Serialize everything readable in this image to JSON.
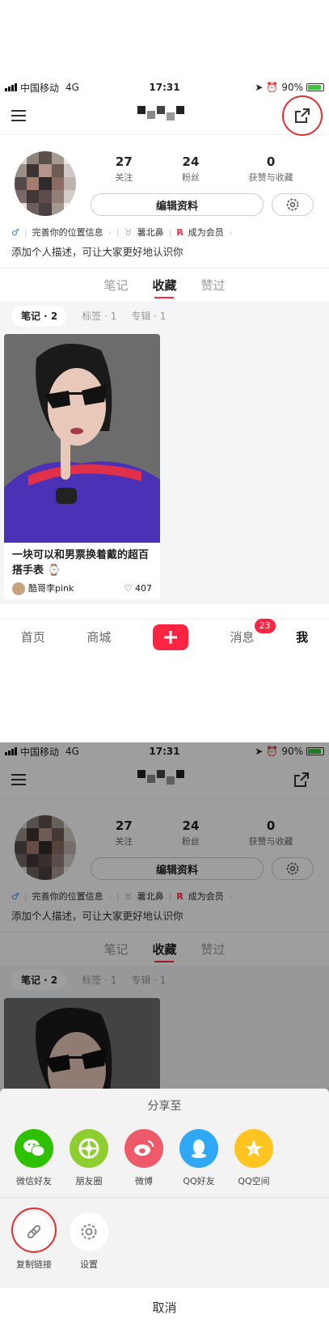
{
  "status_bar": {
    "carrier": "中国移动",
    "network": "4G",
    "time": "17:31",
    "battery": "90%"
  },
  "profile": {
    "stats": [
      {
        "value": "27",
        "label": "关注"
      },
      {
        "value": "24",
        "label": "粉丝"
      },
      {
        "value": "0",
        "label": "获赞与收藏"
      }
    ],
    "edit_label": "编辑资料",
    "tags": [
      "完善你的位置信息",
      "薯北鼻",
      "成为会员"
    ],
    "description": "添加个人描述，可让大家更好地认识你"
  },
  "section_tabs": [
    "笔记",
    "收藏",
    "赞过"
  ],
  "section_active": "收藏",
  "sub_tabs": [
    "笔记 · 2",
    "标签 · 1",
    "专辑 · 1"
  ],
  "card": {
    "title": "一块可以和男票换着戴的超百搭手表 ⌚",
    "author": "酷哥李pink",
    "likes": "407"
  },
  "bottom_nav": {
    "home": "首页",
    "mall": "商城",
    "messages": "消息",
    "message_badge": "23",
    "me": "我"
  },
  "share_sheet": {
    "title": "分享至",
    "targets": [
      {
        "label": "微信好友",
        "icon": "wechat-icon",
        "color": "#2dc100"
      },
      {
        "label": "朋友圈",
        "icon": "moments-icon",
        "color": "#8fce2f"
      },
      {
        "label": "微博",
        "icon": "weibo-icon",
        "color": "#ef5a6a"
      },
      {
        "label": "QQ好友",
        "icon": "qq-icon",
        "color": "#2fa8f6"
      },
      {
        "label": "QQ空间",
        "icon": "qzone-icon",
        "color": "#ffc41f"
      }
    ],
    "actions": [
      {
        "label": "复制链接",
        "icon": "link-icon"
      },
      {
        "label": "设置",
        "icon": "gear-icon"
      }
    ],
    "cancel": "取消"
  },
  "colors": {
    "accent": "#ff2442",
    "highlight_ring": "#e03131"
  }
}
